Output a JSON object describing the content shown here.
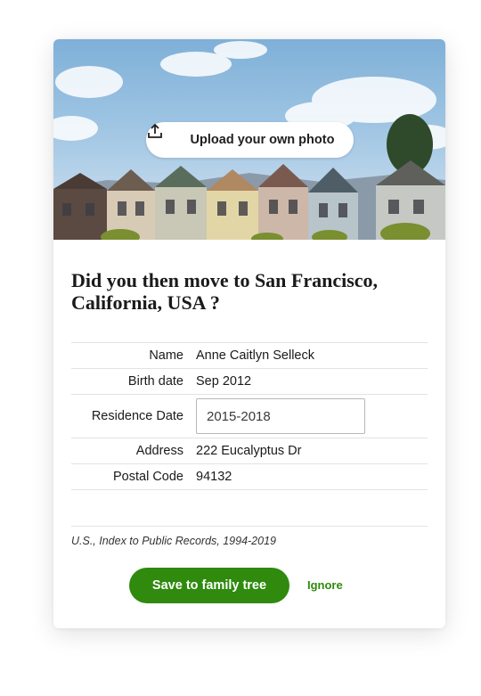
{
  "hero": {
    "upload_label": "Upload your own photo",
    "upload_icon": "upload-icon"
  },
  "question": "Did you then move to San Francisco, California, USA ?",
  "details": {
    "name_label": "Name",
    "name_value": "Anne Caitlyn Selleck",
    "birth_label": "Birth date",
    "birth_value": "Sep 2012",
    "residence_label": "Residence Date",
    "residence_value": "2015-2018",
    "address_label": "Address",
    "address_value": "222 Eucalyptus Dr",
    "postal_label": "Postal Code",
    "postal_value": "94132"
  },
  "source": "U.S., Index to Public Records, 1994-2019",
  "actions": {
    "save_label": "Save to family tree",
    "ignore_label": "Ignore"
  },
  "colors": {
    "accent_green": "#2f8a0d"
  }
}
